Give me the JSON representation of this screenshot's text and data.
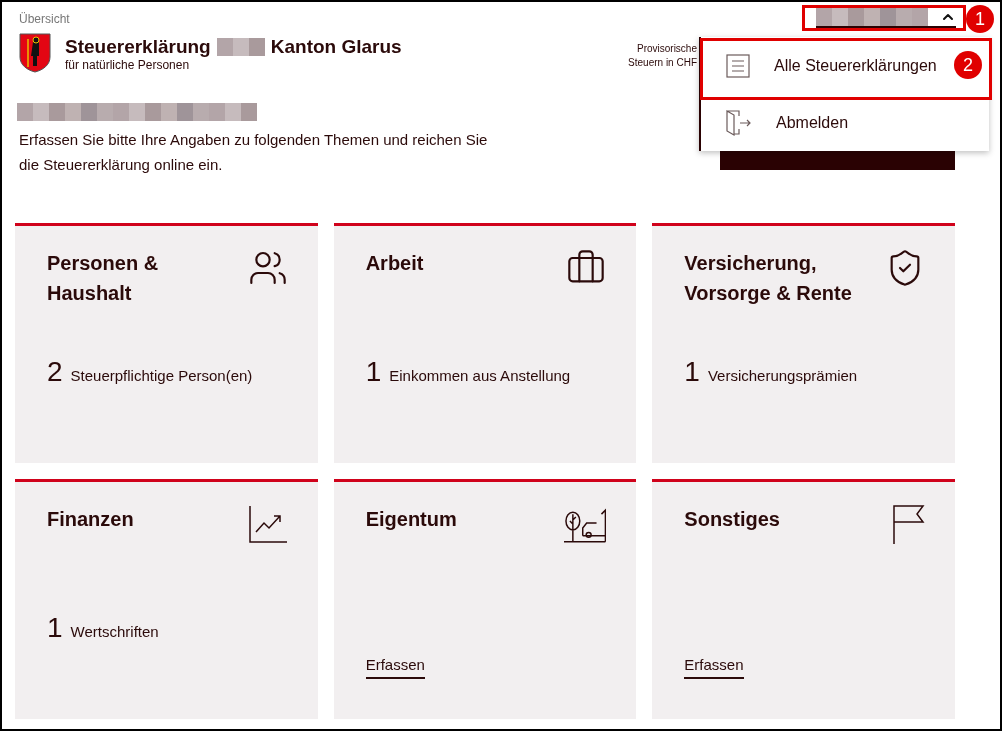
{
  "breadcrumb": "Übersicht",
  "header": {
    "title_start": "Steuererklärung",
    "title_end": "Kanton Glarus",
    "subtitle": "für natürliche Personen",
    "summary_lines": [
      "Provisorische",
      "Steuern in CHF"
    ]
  },
  "intro": "Erfassen Sie bitte Ihre Angaben zu folgenden Themen und reichen Sie die Steuererklärung online ein.",
  "user_menu": {
    "expanded": true,
    "items": [
      {
        "label": "Alle Steuererklärungen",
        "kind": "list"
      },
      {
        "label": "Abmelden",
        "kind": "logout"
      }
    ]
  },
  "cards": [
    {
      "title": "Personen & Haushalt",
      "kind": "people",
      "count": "2",
      "detail": "Steuerpflichtige Person(en)"
    },
    {
      "title": "Arbeit",
      "kind": "briefcase",
      "count": "1",
      "detail": "Einkommen aus Anstellung"
    },
    {
      "title": "Versicherung, Vorsorge & Rente",
      "kind": "shield",
      "count": "1",
      "detail": "Versicherungsprämien"
    },
    {
      "title": "Finanzen",
      "kind": "chart",
      "count": "1",
      "detail": "Wertschriften"
    },
    {
      "title": "Eigentum",
      "kind": "property",
      "link": "Erfassen"
    },
    {
      "title": "Sonstiges",
      "kind": "flag",
      "link": "Erfassen"
    }
  ],
  "annotations": [
    {
      "label": "1"
    },
    {
      "label": "2"
    }
  ]
}
